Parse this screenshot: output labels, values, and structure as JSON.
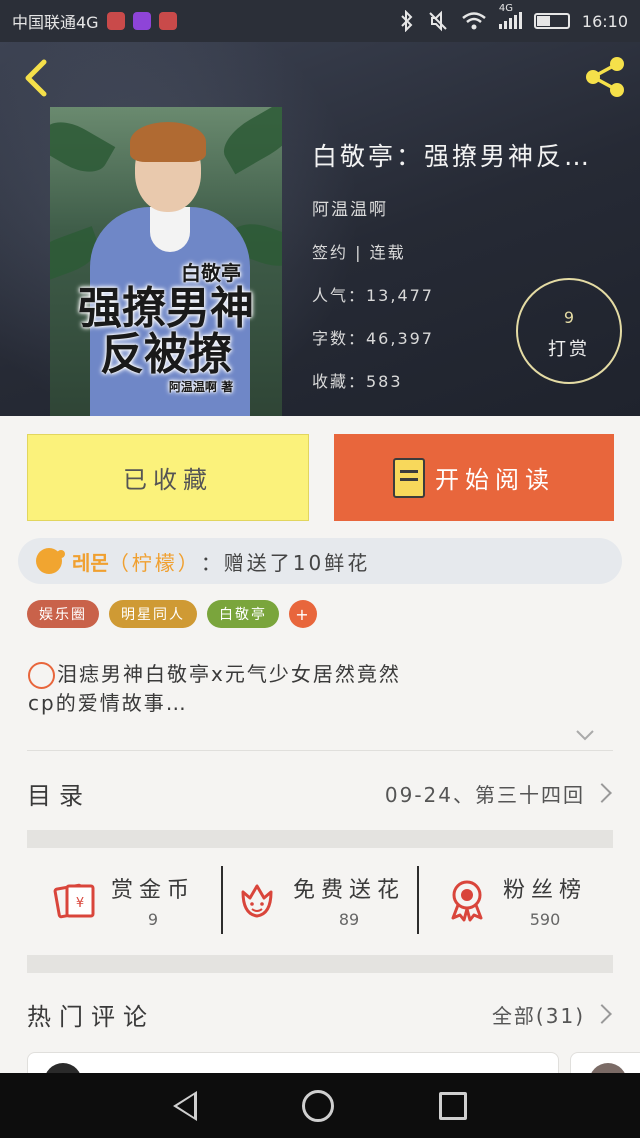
{
  "status_bar": {
    "carrier": "中国联通4G",
    "network": "4G",
    "time": "16:10"
  },
  "book": {
    "title": "白敬亭：强撩男神反…",
    "author": "阿温温啊",
    "status": "签约 | 连载",
    "popularity": "人气：13,477",
    "word_count": "字数：46,397",
    "favorites": "收藏：583",
    "reward_count": "9",
    "reward_label": "打赏",
    "cover": {
      "subtitle": "白敬亭",
      "line1": "强撩男神",
      "line2": "反被撩",
      "author_credit": "阿温温啊 著"
    }
  },
  "actions": {
    "favorite_label": "已收藏",
    "read_label": "开始阅读"
  },
  "gift_banner": {
    "user": "레몬",
    "alias": "（柠檬）",
    "message": "：赠送了10鲜花"
  },
  "tags": [
    {
      "label": "娱乐圈",
      "color": "#c9624a"
    },
    {
      "label": "明星同人",
      "color": "#cf9a34"
    },
    {
      "label": "白敬亭",
      "color": "#7aa53c"
    },
    {
      "label": "+",
      "color": "#e8663c"
    }
  ],
  "description": "泪痣男神白敬亭x元气少女居然竟然cp的爱情故事…",
  "toc": {
    "label": "目录",
    "latest": "09-24、第三十四回"
  },
  "stats": [
    {
      "icon": "red-envelope-icon",
      "label": "赏金币",
      "value": "9"
    },
    {
      "icon": "flower-icon",
      "label": "免费送花",
      "value": "89"
    },
    {
      "icon": "ribbon-medal-icon",
      "label": "粉丝榜",
      "value": "590"
    }
  ],
  "comments": {
    "label": "热门评论",
    "all_label": "全部(31)"
  },
  "colors": {
    "accent_orange": "#e8663c",
    "favorite_yellow": "#fbf27b",
    "gift_orange": "#f0a030",
    "header_dark": "#262a35"
  }
}
